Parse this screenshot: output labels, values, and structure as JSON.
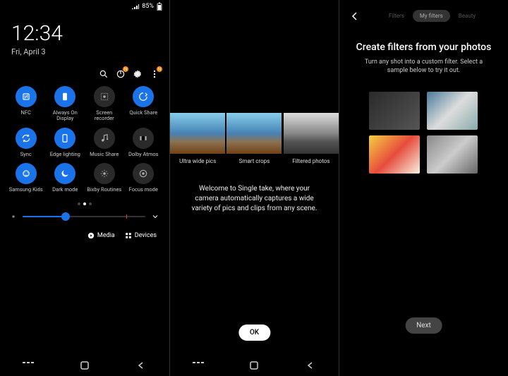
{
  "panel1": {
    "status": {
      "battery": "85%"
    },
    "time": "12:34",
    "date": "Fri, April 3",
    "header_icons": [
      "search",
      "power",
      "settings",
      "more"
    ],
    "tiles": [
      {
        "label": "NFC",
        "on": true
      },
      {
        "label": "Always On Display",
        "on": true
      },
      {
        "label": "Screen recorder",
        "on": false
      },
      {
        "label": "Quick Share",
        "on": true
      },
      {
        "label": "Sync",
        "on": true
      },
      {
        "label": "Edge lighting",
        "on": true
      },
      {
        "label": "Music Share",
        "on": false
      },
      {
        "label": "Dolby Atmos",
        "on": false
      },
      {
        "label": "Samsung Kids",
        "on": true
      },
      {
        "label": "Dark mode",
        "on": true
      },
      {
        "label": "Bixby Routines",
        "on": false
      },
      {
        "label": "Focus mode",
        "on": false
      }
    ],
    "brightness_percent": 35,
    "footer": {
      "media": "Media",
      "devices": "Devices"
    }
  },
  "panel2": {
    "strip": [
      {
        "label": "Ultra wide pics",
        "bw": false
      },
      {
        "label": "Smart crops",
        "bw": false
      },
      {
        "label": "Filtered photos",
        "bw": true
      }
    ],
    "welcome": "Welcome to Single take, where your camera automatically captures a wide variety of pics and clips from any scene.",
    "ok": "OK"
  },
  "panel3": {
    "tabs": [
      "Filters",
      "My filters",
      "Beauty"
    ],
    "active_tab": "My filters",
    "title": "Create filters from your photos",
    "subtitle": "Turn any shot into a custom filter. Select a sample below to try it out.",
    "next": "Next"
  }
}
